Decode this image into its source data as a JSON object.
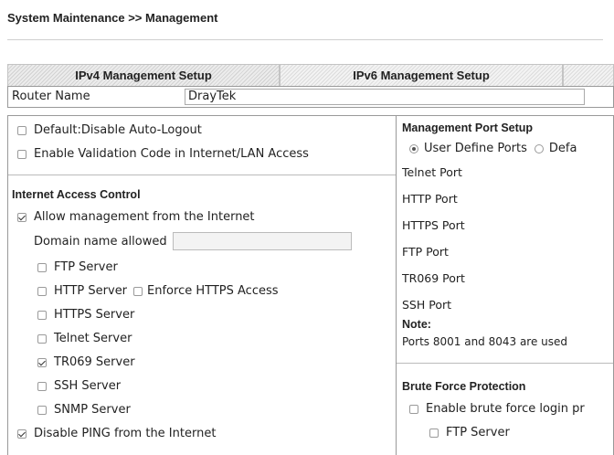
{
  "breadcrumb": "System Maintenance >> Management",
  "tabs": {
    "ipv4": "IPv4 Management Setup",
    "ipv6": "IPv6 Management Setup"
  },
  "router_name": {
    "label": "Router Name",
    "value": "DrayTek"
  },
  "left": {
    "disable_auto_logout": {
      "label": "Default:Disable Auto-Logout",
      "checked": false
    },
    "validation_code": {
      "label": "Enable Validation Code in Internet/LAN Access",
      "checked": false
    },
    "iac_title": "Internet Access Control",
    "allow_mgmt": {
      "label": "Allow management from the Internet",
      "checked": true
    },
    "domain_label": "Domain name allowed",
    "domain_value": "",
    "servers": [
      {
        "label": "FTP Server",
        "checked": false
      },
      {
        "label": "HTTP Server",
        "checked": false
      },
      {
        "label": "HTTPS Server",
        "checked": false
      },
      {
        "label": "Telnet Server",
        "checked": false
      },
      {
        "label": "TR069 Server",
        "checked": true
      },
      {
        "label": "SSH Server",
        "checked": false
      },
      {
        "label": "SNMP Server",
        "checked": false
      }
    ],
    "enforce_https": {
      "label": "Enforce HTTPS Access",
      "checked": false
    },
    "disable_ping": {
      "label": "Disable PING from the Internet",
      "checked": true
    }
  },
  "right": {
    "mps_title": "Management Port Setup",
    "user_define": {
      "label": "User Define Ports",
      "checked": true
    },
    "default_ports": {
      "label": "Defa",
      "checked": false
    },
    "ports": [
      "Telnet Port",
      "HTTP Port",
      "HTTPS Port",
      "FTP Port",
      "TR069 Port",
      "SSH Port"
    ],
    "note_title": "Note:",
    "note_text": "Ports 8001 and 8043 are used",
    "bfp_title": "Brute Force Protection",
    "enable_bf": {
      "label": "Enable brute force login pr",
      "checked": false
    },
    "bf_ftp": {
      "label": "FTP Server",
      "checked": false
    }
  }
}
